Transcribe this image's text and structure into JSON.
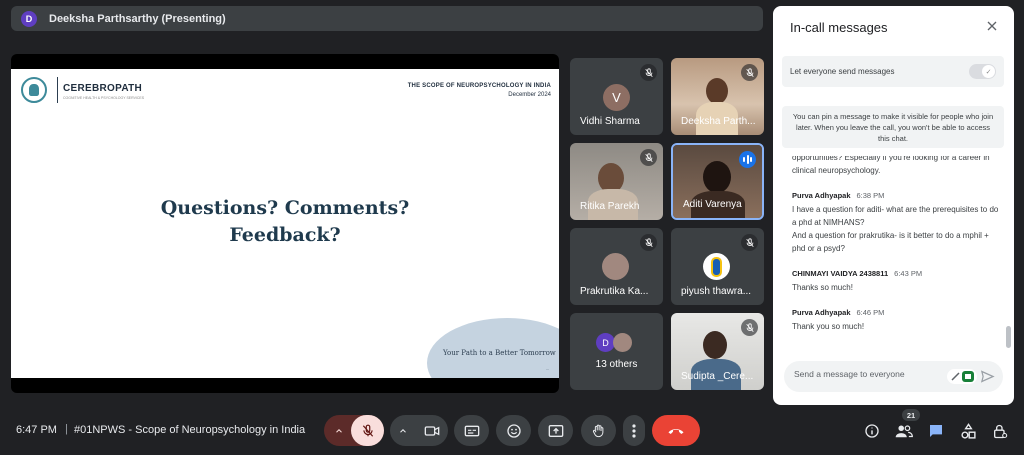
{
  "presenter": {
    "initial": "D",
    "label": "Deeksha Parthsarthy (Presenting)"
  },
  "slide": {
    "brand": "CEREBROPATH",
    "brand_sub": "COGNITIVE HEALTH & PSYCHOLOGY SERVICES",
    "header_title": "THE SCOPE OF NEUROPSYCHOLOGY IN INDIA",
    "header_date": "December 2024",
    "line1": "Questions? Comments?",
    "line2": "Feedback?",
    "tagline": "Your Path to a Better Tomorrow",
    "page_mark": "..."
  },
  "tiles": [
    {
      "name": "Vidhi Sharma",
      "initial": "V"
    },
    {
      "name": "Deeksha Parth..."
    },
    {
      "name": "Ritika Parekh"
    },
    {
      "name": "Aditi Varenya"
    },
    {
      "name": "Prakrutika Ka..."
    },
    {
      "name": "piyush thawra..."
    },
    {
      "name": "13 others",
      "initial": "D"
    },
    {
      "name": "Sudipta _Cere..."
    }
  ],
  "chat": {
    "title": "In-call messages",
    "toggle_label": "Let everyone send messages",
    "toggle_on": true,
    "pin_notice": "You can pin a message to make it visible for people who join later. When you leave the call, you won't be able to access this chat.",
    "continued_text": "opportunities? Especially if you're looking for a career in clinical neuropsychology.",
    "messages": [
      {
        "sender": "Purva Adhyapak",
        "time": "6:38 PM",
        "text": "I have a question for aditi- what are the prerequisites to do a phd at NIMHANS?",
        "text2": "And a question for prakrutika- is it better to do a mphil + phd or a psyd?"
      },
      {
        "sender": "CHINMAYI VAIDYA 2438811",
        "time": "6:43 PM",
        "text": "Thanks so much!"
      },
      {
        "sender": "Purva Adhyapak",
        "time": "6:46 PM",
        "text": "Thank you so much!"
      }
    ],
    "compose_placeholder": "Send a message to everyone"
  },
  "toolbar": {
    "time": "6:47 PM",
    "separator": "|",
    "meeting_title": "#01NPWS - Scope of Neuropsychology in India",
    "participant_count": "21"
  },
  "colors": {
    "end_call": "#ea4335",
    "mic_muted": "#f9dedc",
    "accent": "#1a73e8",
    "chat_icon": "#8ab4f8"
  },
  "icons": [
    "mic-off-icon",
    "camera-icon",
    "captions-icon",
    "emoji-icon",
    "present-icon",
    "raise-hand-icon",
    "more-icon",
    "end-call-icon",
    "info-icon",
    "people-icon",
    "chat-icon",
    "activities-icon",
    "host-controls-icon",
    "close-icon",
    "send-icon"
  ]
}
